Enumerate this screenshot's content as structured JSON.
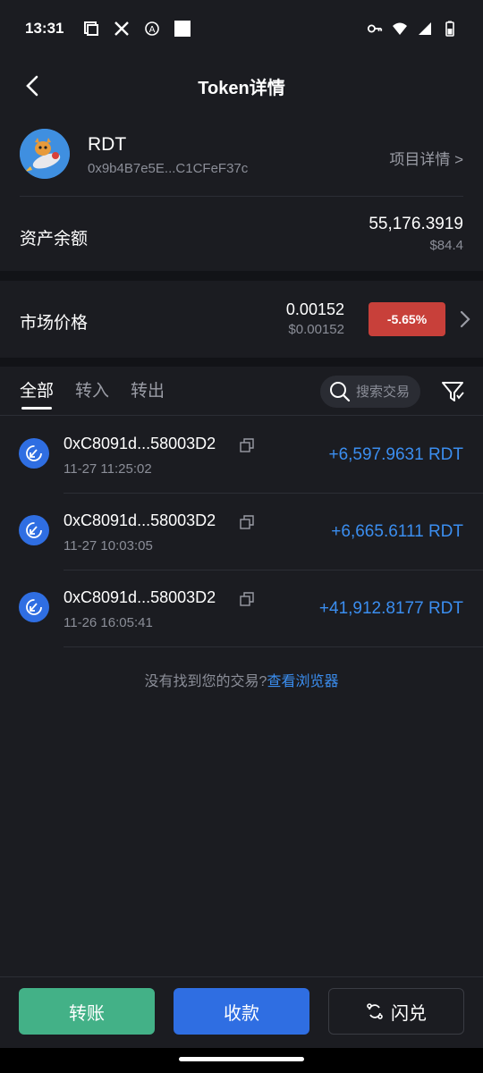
{
  "status_bar": {
    "time": "13:31"
  },
  "nav": {
    "title": "Token详情"
  },
  "token": {
    "symbol": "RDT",
    "address": "0x9b4B7e5E...C1CFeF37c",
    "project_link": "项目详情 >"
  },
  "balance": {
    "label": "资产余额",
    "amount": "55,176.3919",
    "fiat": "$84.4"
  },
  "market": {
    "label": "市场价格",
    "price": "0.00152",
    "fiat": "$0.00152",
    "change": "-5.65%",
    "change_color": "#c8403a"
  },
  "tabs": [
    {
      "label": "全部",
      "active": true
    },
    {
      "label": "转入",
      "active": false
    },
    {
      "label": "转出",
      "active": false
    }
  ],
  "search": {
    "placeholder": "搜索交易"
  },
  "transactions": [
    {
      "hash": "0xC8091d...58003D2",
      "time": "11-27 11:25:02",
      "amount": "+6,597.9631 RDT"
    },
    {
      "hash": "0xC8091d...58003D2",
      "time": "11-27 10:03:05",
      "amount": "+6,665.6111 RDT"
    },
    {
      "hash": "0xC8091d...58003D2",
      "time": "11-26 16:05:41",
      "amount": "+41,912.8177 RDT"
    }
  ],
  "not_found": {
    "text": "没有找到您的交易?",
    "link": "查看浏览器"
  },
  "actions": {
    "transfer": "转账",
    "receive": "收款",
    "swap": "闪兑"
  },
  "colors": {
    "background": "#1b1c21",
    "accent_blue": "#2f6ee2",
    "accent_green": "#43b187",
    "amount_blue": "#3b8ef0"
  }
}
